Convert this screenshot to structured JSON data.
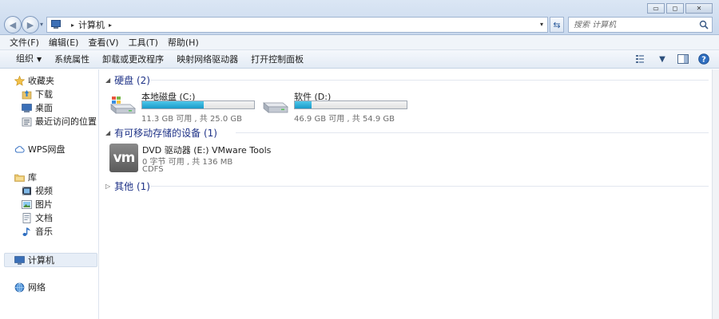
{
  "window": {
    "minimize_glyph": "▭",
    "maximize_glyph": "◻",
    "close_glyph": "✕"
  },
  "nav": {
    "back_glyph": "◀",
    "forward_glyph": "▶",
    "dropdown_glyph": "▾"
  },
  "address": {
    "separator": "▸",
    "path": "计算机",
    "trailing_separator": "▸",
    "dropdown_glyph": "▾",
    "icon": "computer-icon"
  },
  "refresh_glyph": "⇆",
  "search": {
    "placeholder": "搜索 计算机",
    "icon": "search-icon"
  },
  "menu": [
    "文件(F)",
    "编辑(E)",
    "查看(V)",
    "工具(T)",
    "帮助(H)"
  ],
  "commands": {
    "organize": "组织",
    "organize_caret": "▼",
    "items": [
      "系统属性",
      "卸载或更改程序",
      "映射网络驱动器",
      "打开控制面板"
    ],
    "view_caret": "▼"
  },
  "sidebar": {
    "favorites": {
      "label": "收藏夹",
      "items": [
        "下载",
        "桌面",
        "最近访问的位置"
      ]
    },
    "wps": "WPS网盘",
    "library": {
      "label": "库",
      "items": [
        "视频",
        "图片",
        "文档",
        "音乐"
      ]
    },
    "computer": "计算机",
    "network": "网络"
  },
  "groups": {
    "hard_disks": {
      "title": "硬盘 (2)",
      "triangle": "◢"
    },
    "removable": {
      "title": "有可移动存储的设备 (1)",
      "triangle": "◢"
    },
    "other": {
      "title": "其他 (1)",
      "triangle": "▷"
    }
  },
  "drives": [
    {
      "name": "本地磁盘 (C:)",
      "info": "11.3 GB 可用 , 共 25.0 GB",
      "used_fraction": 0.55
    },
    {
      "name": "软件 (D:)",
      "info": "46.9 GB 可用 , 共 54.9 GB",
      "used_fraction": 0.15
    }
  ],
  "dvd": {
    "logo": "vm",
    "name": "DVD 驱动器 (E:) VMware Tools",
    "info": "0 字节 可用 , 共 136 MB",
    "fs": "CDFS"
  },
  "colors": {
    "accent": "#1e3287",
    "drive_fill": "#26a5d4"
  }
}
